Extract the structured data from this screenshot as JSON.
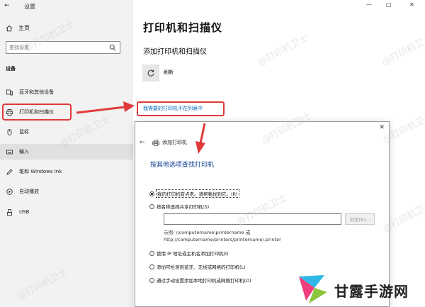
{
  "window": {
    "title": "设置",
    "controls": [
      "—",
      "□",
      "✕"
    ]
  },
  "sidebar": {
    "back": "←",
    "home_label": "主页",
    "search_placeholder": "查找设置",
    "section_label": "设备",
    "items": [
      {
        "label": "蓝牙和其他设备",
        "icon": "bluetooth-devices-icon"
      },
      {
        "label": "打印机和扫描仪",
        "icon": "printer-icon",
        "active": true
      },
      {
        "label": "鼠标",
        "icon": "mouse-icon"
      },
      {
        "label": "输入",
        "icon": "keyboard-icon"
      },
      {
        "label": "笔和 Windows Ink",
        "icon": "pen-icon"
      },
      {
        "label": "自动播放",
        "icon": "autoplay-icon"
      },
      {
        "label": "USB",
        "icon": "usb-icon"
      }
    ]
  },
  "main": {
    "title": "打印机和扫描仪",
    "add_heading": "添加打印机和扫描仪",
    "refresh_label": "刷新",
    "missing_link": "我需要的打印机不在列表中"
  },
  "dialog": {
    "close": "✕",
    "back": "←",
    "title": "添加打印机",
    "heading": "按其他选项查找打印机",
    "options": [
      {
        "label": "我的打印机有点老。请帮我找到它。(R)",
        "checked": true
      },
      {
        "label": "按名称选择共享打印机(S)",
        "checked": false
      },
      {
        "label": "使用 IP 地址或主机名添加打印机(I)",
        "checked": false
      },
      {
        "label": "添加可检测到蓝牙、无线或网络的打印机(L)",
        "checked": false
      },
      {
        "label": "通过手动设置添加本地打印机或网络打印机(O)",
        "checked": false
      }
    ],
    "browse_label": "浏览(R)...",
    "example_line1": "示例: \\\\computername\\printername 或",
    "example_line2": "http://computername/printers/printername/.printer"
  },
  "watermark": "@打印机卫士",
  "logo": {
    "text": "甘露手游网",
    "colors": [
      "#2fb7e6",
      "#ef3e7d",
      "#8dc63f"
    ]
  },
  "colors": {
    "accent": "#0067b8",
    "highlight_red": "#e03a3a",
    "dialog_heading": "#0b3a8f"
  }
}
